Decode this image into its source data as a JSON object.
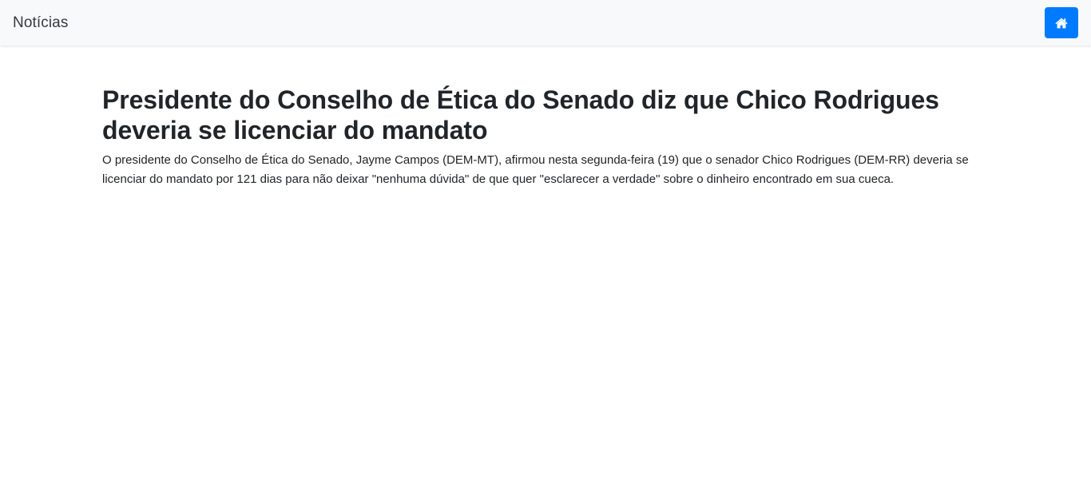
{
  "navbar": {
    "brand": "Notícias",
    "home_icon": "home-icon",
    "accent_color": "#007bff",
    "background_color": "#f8f9fa"
  },
  "article": {
    "title": "Presidente do Conselho de Ética do Senado diz que Chico Rodrigues deveria se licenciar do mandato",
    "summary": "O presidente do Conselho de Ética do Senado, Jayme Campos (DEM-MT), afirmou nesta segunda-feira (19) que o senador Chico Rodrigues (DEM-RR) deveria se licenciar do mandato por 121 dias para não deixar \"nenhuma dúvida\" de que quer \"esclarecer a verdade\" sobre o dinheiro encontrado em sua cueca."
  }
}
